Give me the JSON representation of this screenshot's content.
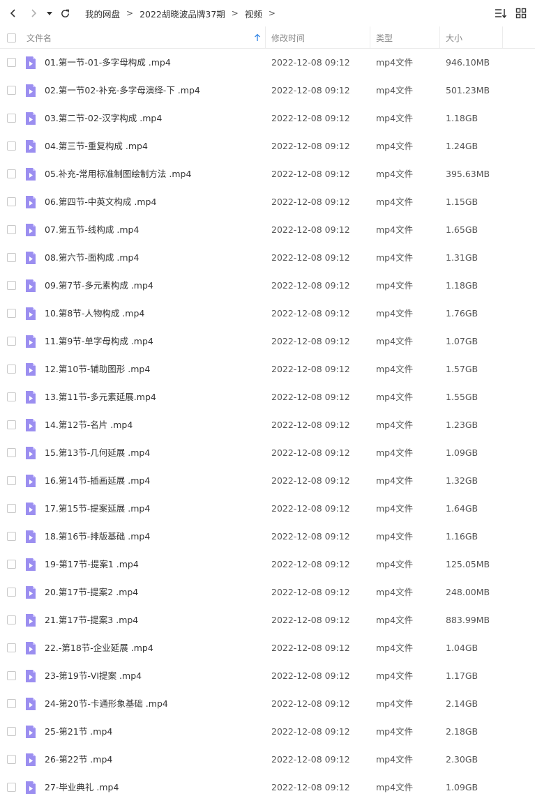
{
  "toolbar": {
    "back_icon": "chevron-left-icon",
    "forward_icon": "chevron-right-icon",
    "dropdown_icon": "caret-down-icon",
    "refresh_icon": "refresh-icon",
    "sort_icon": "sort-list-icon",
    "grid_icon": "grid-view-icon",
    "breadcrumb": [
      "我的网盘",
      "2022胡晓波品牌37期",
      "视频"
    ],
    "separator": ">"
  },
  "columns": {
    "name": "文件名",
    "modified": "修改时间",
    "type": "类型",
    "size": "大小"
  },
  "colors": {
    "file_icon": "#9b8ef0",
    "file_icon_fold": "#c7beff",
    "sort_arrow": "#3b8ae6"
  },
  "files": [
    {
      "name": "01.第一节-01-多字母构成 .mp4",
      "date": "2022-12-08 09:12",
      "type": "mp4文件",
      "size": "946.10MB"
    },
    {
      "name": "02.第一节02-补充-多字母演绎-下 .mp4",
      "date": "2022-12-08 09:12",
      "type": "mp4文件",
      "size": "501.23MB"
    },
    {
      "name": "03.第二节-02-汉字构成 .mp4",
      "date": "2022-12-08 09:12",
      "type": "mp4文件",
      "size": "1.18GB"
    },
    {
      "name": "04.第三节-重复构成 .mp4",
      "date": "2022-12-08 09:12",
      "type": "mp4文件",
      "size": "1.24GB"
    },
    {
      "name": "05.补充-常用标准制图绘制方法 .mp4",
      "date": "2022-12-08 09:12",
      "type": "mp4文件",
      "size": "395.63MB"
    },
    {
      "name": "06.第四节-中英文构成 .mp4",
      "date": "2022-12-08 09:12",
      "type": "mp4文件",
      "size": "1.15GB"
    },
    {
      "name": "07.第五节-线构成 .mp4",
      "date": "2022-12-08 09:12",
      "type": "mp4文件",
      "size": "1.65GB"
    },
    {
      "name": "08.第六节-面构成 .mp4",
      "date": "2022-12-08 09:12",
      "type": "mp4文件",
      "size": "1.31GB"
    },
    {
      "name": "09.第7节-多元素构成 .mp4",
      "date": "2022-12-08 09:12",
      "type": "mp4文件",
      "size": "1.18GB"
    },
    {
      "name": "10.第8节-人物构成 .mp4",
      "date": "2022-12-08 09:12",
      "type": "mp4文件",
      "size": "1.76GB"
    },
    {
      "name": "11.第9节-单字母构成 .mp4",
      "date": "2022-12-08 09:12",
      "type": "mp4文件",
      "size": "1.07GB"
    },
    {
      "name": "12.第10节-辅助图形 .mp4",
      "date": "2022-12-08 09:12",
      "type": "mp4文件",
      "size": "1.57GB"
    },
    {
      "name": "13.第11节-多元素延展.mp4",
      "date": "2022-12-08 09:12",
      "type": "mp4文件",
      "size": "1.55GB"
    },
    {
      "name": "14.第12节-名片 .mp4",
      "date": "2022-12-08 09:12",
      "type": "mp4文件",
      "size": "1.23GB"
    },
    {
      "name": "15.第13节-几何延展 .mp4",
      "date": "2022-12-08 09:12",
      "type": "mp4文件",
      "size": "1.09GB"
    },
    {
      "name": "16.第14节-插画延展 .mp4",
      "date": "2022-12-08 09:12",
      "type": "mp4文件",
      "size": "1.32GB"
    },
    {
      "name": "17.第15节-提案延展 .mp4",
      "date": "2022-12-08 09:12",
      "type": "mp4文件",
      "size": "1.64GB"
    },
    {
      "name": "18.第16节-排版基础 .mp4",
      "date": "2022-12-08 09:12",
      "type": "mp4文件",
      "size": "1.16GB"
    },
    {
      "name": "19-第17节-提案1  .mp4",
      "date": "2022-12-08 09:12",
      "type": "mp4文件",
      "size": "125.05MB"
    },
    {
      "name": "20.第17节-提案2  .mp4",
      "date": "2022-12-08 09:12",
      "type": "mp4文件",
      "size": "248.00MB"
    },
    {
      "name": "21.第17节-提案3  .mp4",
      "date": "2022-12-08 09:12",
      "type": "mp4文件",
      "size": "883.99MB"
    },
    {
      "name": "22.-第18节-企业延展 .mp4",
      "date": "2022-12-08 09:12",
      "type": "mp4文件",
      "size": "1.04GB"
    },
    {
      "name": "23-第19节-VI提案 .mp4",
      "date": "2022-12-08 09:12",
      "type": "mp4文件",
      "size": "1.17GB"
    },
    {
      "name": "24-第20节-卡通形象基础 .mp4",
      "date": "2022-12-08 09:12",
      "type": "mp4文件",
      "size": "2.14GB"
    },
    {
      "name": "25-第21节 .mp4",
      "date": "2022-12-08 09:12",
      "type": "mp4文件",
      "size": "2.18GB"
    },
    {
      "name": "26-第22节 .mp4",
      "date": "2022-12-08 09:12",
      "type": "mp4文件",
      "size": "2.30GB"
    },
    {
      "name": "27-毕业典礼 .mp4",
      "date": "2022-12-08 09:12",
      "type": "mp4文件",
      "size": "1.09GB"
    }
  ]
}
